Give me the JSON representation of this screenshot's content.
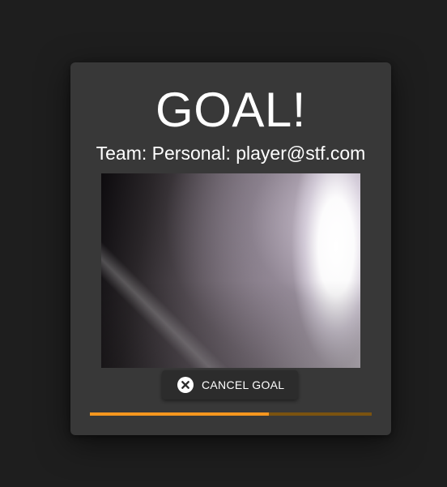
{
  "dialog": {
    "title": "GOAL!",
    "subtitle": "Team: Personal: player@stf.com",
    "snapshot_alt": "goal camera snapshot",
    "cancel_button": {
      "label": "CANCEL GOAL",
      "icon": "close-circle-icon"
    },
    "progress": {
      "fraction": 0.635,
      "fill_color": "#f5961e",
      "track_color": "#7a5310"
    }
  }
}
